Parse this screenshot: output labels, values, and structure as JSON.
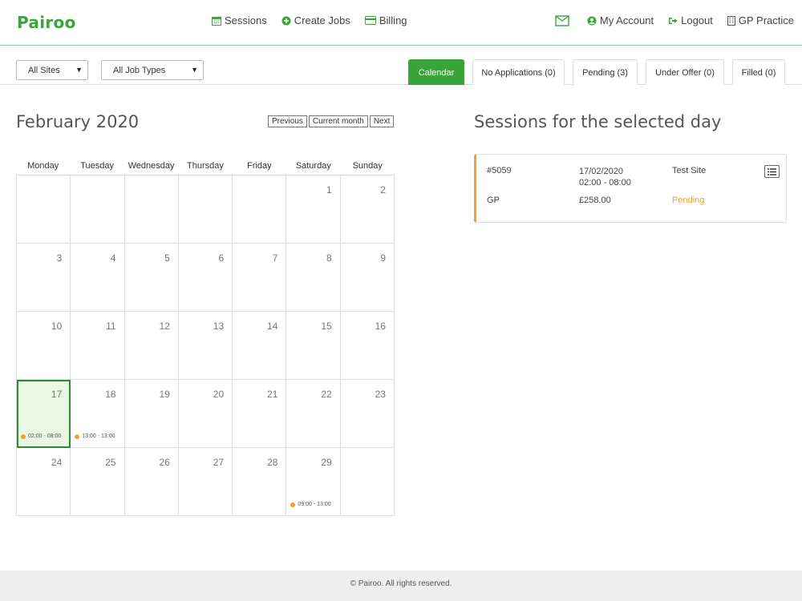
{
  "brand": {
    "name": "Pairoo",
    "color": "#3aa33a"
  },
  "nav": {
    "sessions": "Sessions",
    "create_jobs": "Create Jobs",
    "billing": "Billing",
    "my_account": "My Account",
    "logout": "Logout",
    "practice": "GP Practice"
  },
  "filters": {
    "sites": "All Sites",
    "job_types": "All Job Types"
  },
  "tabs": {
    "calendar": "Calendar",
    "no_applications": "No Applications (0)",
    "pending": "Pending (3)",
    "under_offer": "Under Offer (0)",
    "filled": "Filled (0)"
  },
  "calendar": {
    "month": "February 2020",
    "buttons": {
      "previous": "Previous",
      "current": "Current month",
      "next": "Next"
    },
    "weekdays": [
      "Monday",
      "Tuesday",
      "Wednesday",
      "Thursday",
      "Friday",
      "Saturday",
      "Sunday"
    ],
    "cells": [
      {
        "day": ""
      },
      {
        "day": ""
      },
      {
        "day": ""
      },
      {
        "day": ""
      },
      {
        "day": ""
      },
      {
        "day": "1"
      },
      {
        "day": "2"
      },
      {
        "day": "3"
      },
      {
        "day": "4"
      },
      {
        "day": "5"
      },
      {
        "day": "6"
      },
      {
        "day": "7"
      },
      {
        "day": "8"
      },
      {
        "day": "9"
      },
      {
        "day": "10"
      },
      {
        "day": "11"
      },
      {
        "day": "12"
      },
      {
        "day": "13"
      },
      {
        "day": "14"
      },
      {
        "day": "15"
      },
      {
        "day": "16"
      },
      {
        "day": "17",
        "selected": true,
        "event": "02:00 - 08:00"
      },
      {
        "day": "18",
        "event": "13:00 - 13:00"
      },
      {
        "day": "19"
      },
      {
        "day": "20"
      },
      {
        "day": "21"
      },
      {
        "day": "22"
      },
      {
        "day": "23"
      },
      {
        "day": "24"
      },
      {
        "day": "25"
      },
      {
        "day": "26"
      },
      {
        "day": "27"
      },
      {
        "day": "28"
      },
      {
        "day": "29",
        "event": "09:00 - 13:00"
      },
      {
        "day": ""
      }
    ]
  },
  "sessions": {
    "title": "Sessions for the selected day",
    "card": {
      "id": "#5059",
      "date": "17/02/2020",
      "time": "02:00 - 08:00",
      "site": "Test Site",
      "role": "GP",
      "price": "£258.00",
      "status": "Pending",
      "status_color": "#f0a030"
    }
  },
  "footer": {
    "text": "© Pairoo. All rights reserved."
  }
}
